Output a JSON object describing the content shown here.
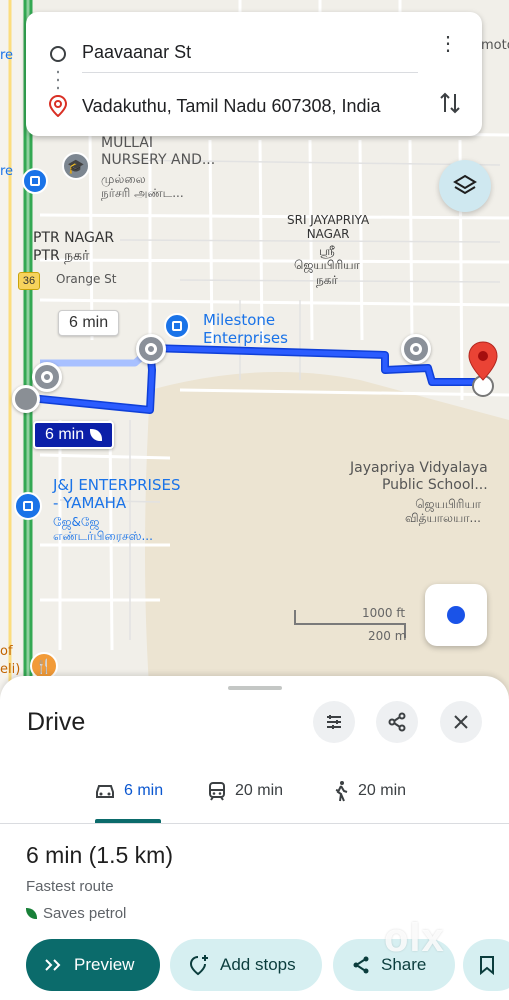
{
  "directions": {
    "origin": "Paavaanar St",
    "destination": "Vadakuthu, Tamil Nadu 607308, India"
  },
  "map": {
    "labels": {
      "nursery_en": "MULLAI\nNURSERY AND...",
      "nursery_ta": "முல்லை\nநர்சரி அண்ட...",
      "ptr_en": "PTR NAGAR",
      "ptr_ta": "PTR நகர்",
      "orange": "Orange St",
      "sri_en": "SRI JAYAPRIYA\nNAGAR",
      "sri_ta": "ஸ்ரீ\nஜெயபிரியா\nநகர்",
      "milestone": "Milestone\nEnterprises",
      "jj_en": "J&J ENTERPRISES\n- YAMAHA",
      "jj_ta": "ஜே&ஜே\nஎண்டர்பிரைசஸ்...",
      "school_en": "Jayapriya Vidyalaya\nPublic School...",
      "school_ta": "ஜெயபிரியா\nவித்யாலயா...",
      "road_num": "36",
      "left_edge_1": "re",
      "left_edge_2": "re",
      "left_edge_3": "of",
      "left_edge_4": "eli)",
      "right_edge_1": "moto",
      "scale_ft": "1000 ft",
      "scale_m": "200 m"
    },
    "route_alt_time": "6 min",
    "route_main_time": "6 min",
    "colors": {
      "route": "#1a1aff",
      "route_alt": "#a8c0ff",
      "highway": "#34a853"
    }
  },
  "sheet": {
    "title": "Drive",
    "modes": [
      {
        "icon": "car-icon",
        "label": "6 min"
      },
      {
        "icon": "train-icon",
        "label": "20 min"
      },
      {
        "icon": "walk-icon",
        "label": "20 min"
      }
    ],
    "duration": "6 min",
    "distance": "(1.5 km)",
    "route_note": "Fastest route",
    "petrol_note": "Saves petrol",
    "buttons": {
      "preview": "Preview",
      "add_stops": "Add stops",
      "share": "Share"
    }
  },
  "watermark": "olx"
}
